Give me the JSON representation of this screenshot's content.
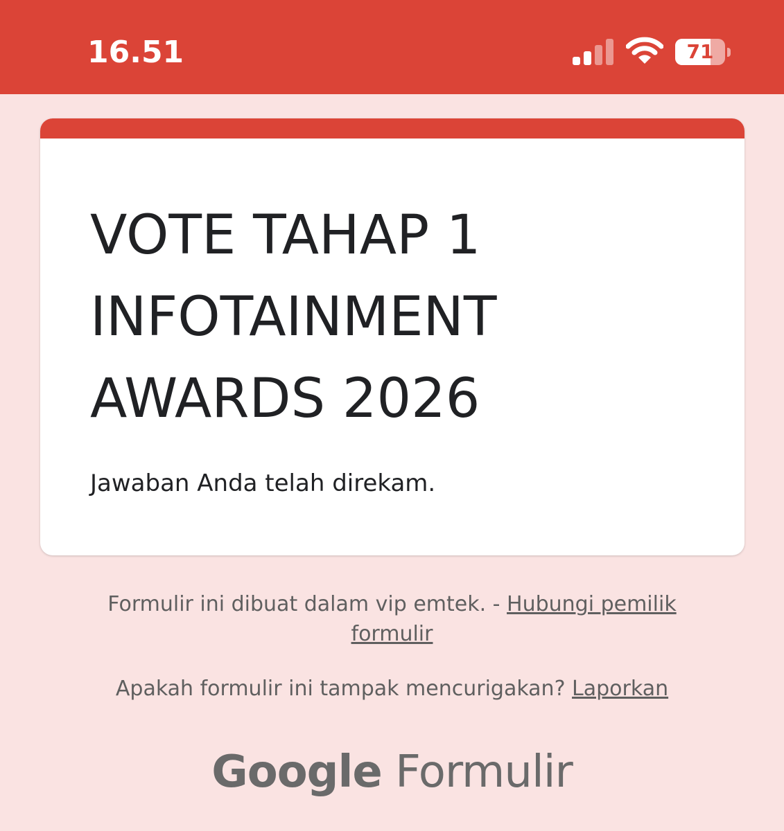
{
  "status_bar": {
    "time": "16.51",
    "battery_level": "71",
    "battery_fraction": 0.71,
    "signal_bars_active": 2,
    "signal_bars_total": 4,
    "background_color": "#db4437",
    "icons": [
      "signal-icon",
      "wifi-icon",
      "battery-icon"
    ]
  },
  "form": {
    "title": "VOTE TAHAP 1 INFOTAINMENT AWARDS 2026",
    "confirmation_message": "Jawaban Anda telah direkam.",
    "accent_color": "#db4437",
    "background_color": "#fae3e2"
  },
  "footer": {
    "created_text": "Formulir ini dibuat dalam vip emtek. - ",
    "contact_owner_link": "Hubungi pemilik formulir",
    "report_question": "Apakah formulir ini tampak mencurigakan? ",
    "report_link": "Laporkan",
    "logo_google": "Google",
    "logo_product": "Formulir"
  }
}
